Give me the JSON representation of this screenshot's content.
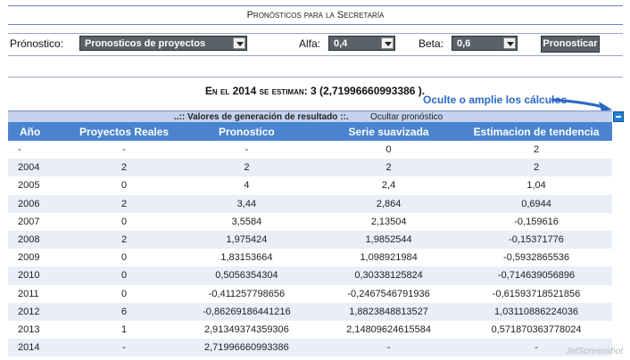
{
  "title": "Pronósticos para la Secretaría",
  "controls": {
    "pronostico_label": "Prónostico:",
    "pronostico_value": "Pronosticos de proyectos",
    "alfa_label": "Alfa:",
    "alfa_value": "0,4",
    "beta_label": "Beta:",
    "beta_value": "0,6",
    "button_label": "Pronosticar"
  },
  "summary": {
    "prefix": "En el",
    "year": "2014",
    "middle": "se estiman:",
    "result": "3 (2,71996660993386 )."
  },
  "tip": "Oculte o amplie los cálculos",
  "panel": {
    "title": "..:: Valores de generación de resultado ::.",
    "toggle": "Ocultar pronóstico"
  },
  "table": {
    "headers": [
      "Año",
      "Proyectos Reales",
      "Pronostico",
      "Serie suavizada",
      "Estimacion de tendencia"
    ],
    "rows": [
      [
        "-",
        "-",
        "-",
        "0",
        "2"
      ],
      [
        "2004",
        "2",
        "2",
        "2",
        "2"
      ],
      [
        "2005",
        "0",
        "4",
        "2,4",
        "1,04"
      ],
      [
        "2006",
        "2",
        "3,44",
        "2,864",
        "0,6944"
      ],
      [
        "2007",
        "0",
        "3,5584",
        "2,13504",
        "-0,159616"
      ],
      [
        "2008",
        "2",
        "1,975424",
        "1,9852544",
        "-0,15371776"
      ],
      [
        "2009",
        "0",
        "1,83153664",
        "1,098921984",
        "-0,5932865536"
      ],
      [
        "2010",
        "0",
        "0,5056354304",
        "0,30338125824",
        "-0,714639056896"
      ],
      [
        "2011",
        "0",
        "-0,411257798656",
        "-0,2467546791936",
        "-0,61593718521856"
      ],
      [
        "2012",
        "6",
        "-0,86269186441216",
        "1,8823848813527",
        "1,03110886224036"
      ],
      [
        "2013",
        "1",
        "2,91349374359306",
        "2,14809624615584",
        "0,571870363778024"
      ],
      [
        "2014",
        "-",
        "2,71996660993386",
        "-",
        "-"
      ]
    ]
  },
  "watermark": "JetScreenshot"
}
